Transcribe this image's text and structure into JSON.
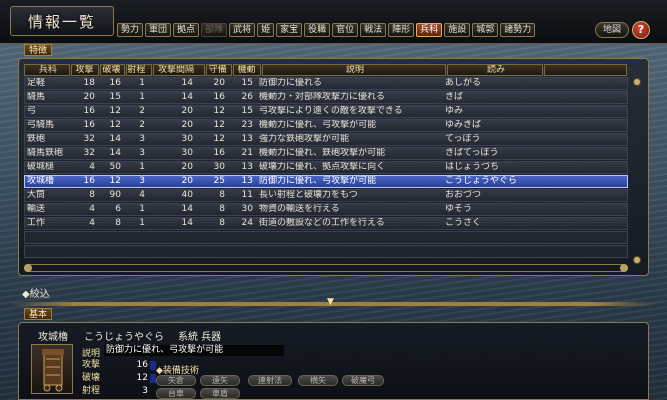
{
  "window": {
    "title": "情報一覧"
  },
  "tabs": [
    {
      "label": "勢力",
      "state": "normal"
    },
    {
      "label": "軍団",
      "state": "normal"
    },
    {
      "label": "拠点",
      "state": "normal"
    },
    {
      "label": "部隊",
      "state": "disabled"
    },
    {
      "label": "武将",
      "state": "normal"
    },
    {
      "label": "姫",
      "state": "normal"
    },
    {
      "label": "家宝",
      "state": "normal"
    },
    {
      "label": "役職",
      "state": "normal"
    },
    {
      "label": "官位",
      "state": "normal"
    },
    {
      "label": "戦法",
      "state": "normal"
    },
    {
      "label": "陣形",
      "state": "normal"
    },
    {
      "label": "兵科",
      "state": "active"
    },
    {
      "label": "施設",
      "state": "normal"
    },
    {
      "label": "城郭",
      "state": "normal"
    },
    {
      "label": "諸勢力",
      "state": "normal"
    }
  ],
  "top_buttons": {
    "map": "地図",
    "help": "?"
  },
  "section_label": "特徴",
  "table": {
    "headers": [
      "兵科",
      "攻撃",
      "破壊",
      "射程",
      "攻撃間隔",
      "守備",
      "機動",
      "説明",
      "読み",
      ""
    ],
    "rows": [
      [
        "足軽",
        "18",
        "16",
        "1",
        "14",
        "20",
        "15",
        "防御力に優れる",
        "あしがる",
        ""
      ],
      [
        "騎馬",
        "20",
        "15",
        "1",
        "14",
        "16",
        "26",
        "機動力・対部隊攻撃力に優れる",
        "きば",
        ""
      ],
      [
        "弓",
        "16",
        "12",
        "2",
        "20",
        "12",
        "15",
        "弓攻撃により遠くの敵を攻撃できる",
        "ゆみ",
        ""
      ],
      [
        "弓騎馬",
        "16",
        "12",
        "2",
        "20",
        "12",
        "23",
        "機動力に優れ、弓攻撃が可能",
        "ゆみきば",
        ""
      ],
      [
        "鉄砲",
        "32",
        "14",
        "3",
        "30",
        "12",
        "13",
        "強力な鉄砲攻撃が可能",
        "てっぽう",
        ""
      ],
      [
        "騎馬鉄砲",
        "32",
        "14",
        "3",
        "30",
        "16",
        "21",
        "機動力に優れ、鉄砲攻撃が可能",
        "きばてっぽう",
        ""
      ],
      [
        "破城槌",
        "4",
        "50",
        "1",
        "20",
        "30",
        "13",
        "破壊力に優れ、拠点攻撃に向く",
        "はじょうづち",
        ""
      ],
      [
        "攻城櫓",
        "16",
        "12",
        "3",
        "20",
        "25",
        "13",
        "防御力に優れ、弓攻撃が可能",
        "こうじょうやぐら",
        ""
      ],
      [
        "大筒",
        "8",
        "90",
        "4",
        "40",
        "8",
        "11",
        "長い射程と破壊力をもつ",
        "おおづつ",
        ""
      ],
      [
        "輸送",
        "4",
        "6",
        "1",
        "14",
        "8",
        "30",
        "物資の輸送を行える",
        "ゆそう",
        ""
      ],
      [
        "工作",
        "4",
        "8",
        "1",
        "14",
        "8",
        "24",
        "街道の敷設などの工作を行える",
        "こうさく",
        ""
      ]
    ],
    "selected_index": 7
  },
  "filter_button": "絞込",
  "detail": {
    "tab_label": "基本",
    "name": "攻城櫓",
    "reading": "こうじょうやぐら",
    "type": "系統 兵器",
    "desc_label": "説明",
    "desc": "防御力に優れ、弓攻撃が可能",
    "stats": [
      {
        "label": "攻撃",
        "value": "16"
      },
      {
        "label": "破壊",
        "value": "12"
      },
      {
        "label": "射程",
        "value": "3"
      }
    ],
    "equip_title": "装備技術",
    "equipment": [
      "矢倉",
      "遠矢",
      "連射法",
      "横矢",
      "破魔弓",
      "台車",
      "車盾"
    ]
  },
  "colors": {
    "selected_row": "#3a55b8",
    "active_tab": "#a04a2a",
    "gold_border": "#8b7a4a"
  }
}
